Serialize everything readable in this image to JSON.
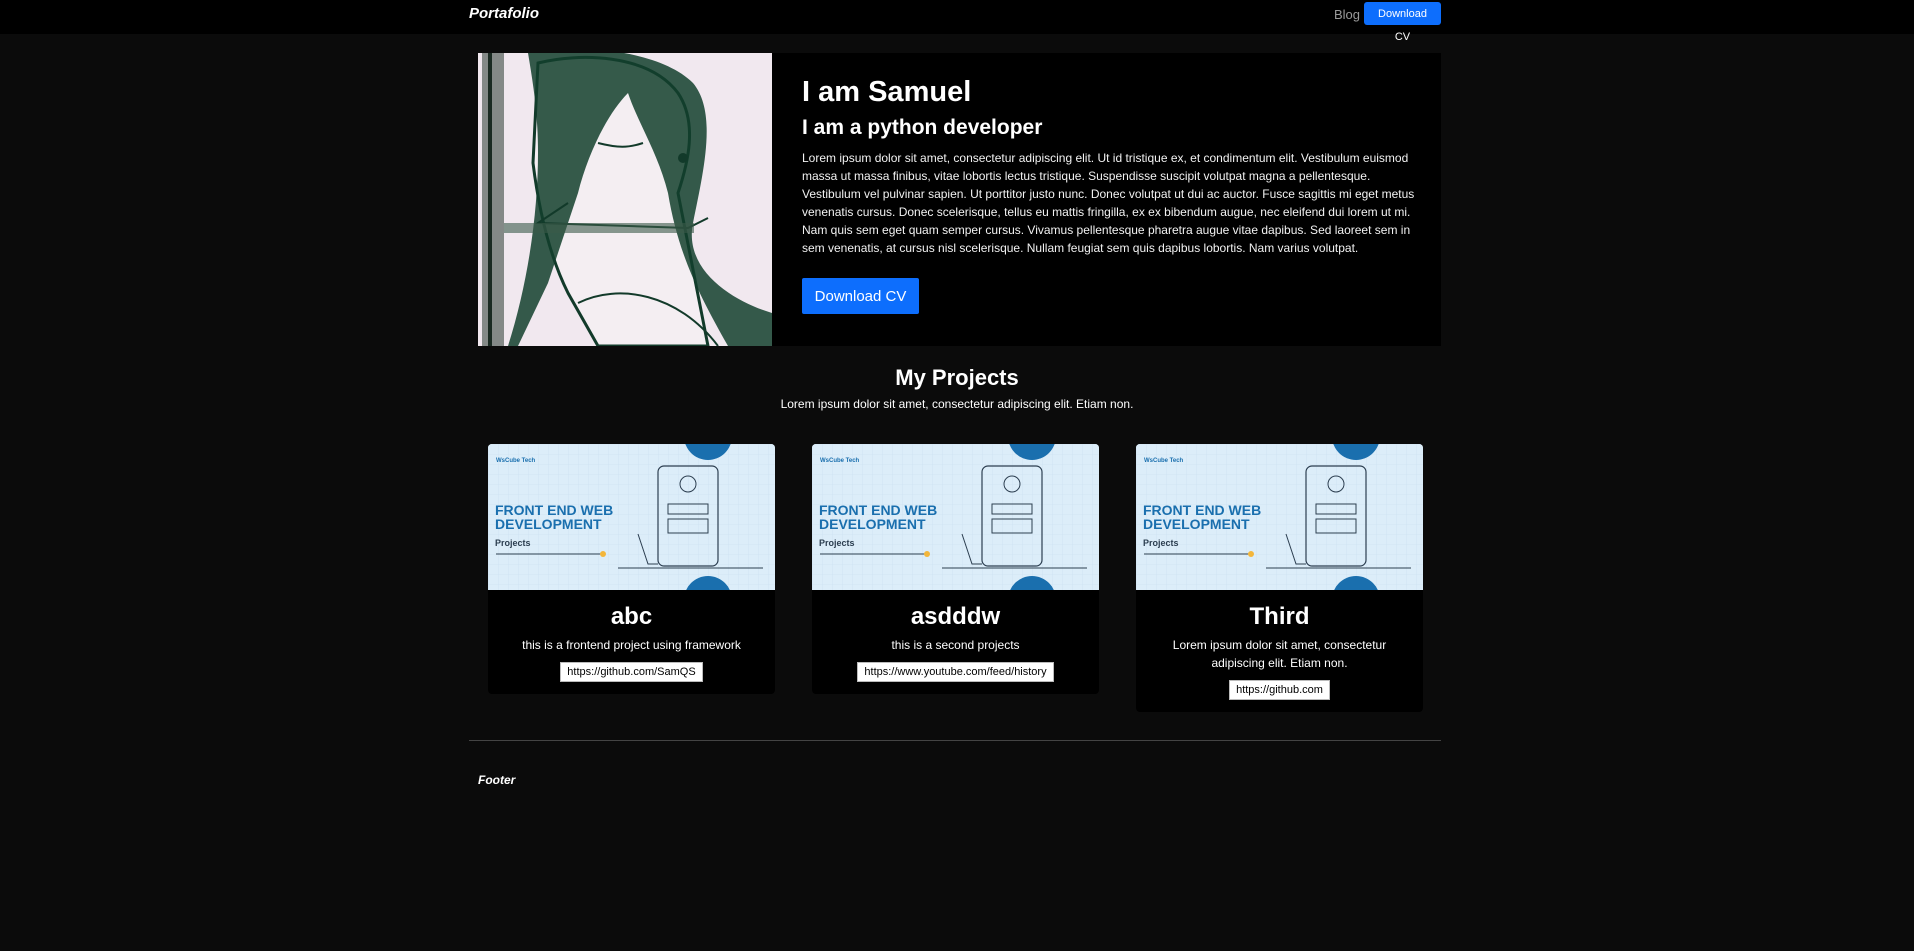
{
  "nav": {
    "brand": "Portafolio",
    "links": [
      {
        "label": "Blog"
      }
    ],
    "cta": "Download CV"
  },
  "hero": {
    "title_prefix": "I am ",
    "name": "Samuel",
    "subtitle": "I am a python developer",
    "description": "Lorem ipsum dolor sit amet, consectetur adipiscing elit. Ut id tristique ex, et condimentum elit. Vestibulum euismod massa ut massa finibus, vitae lobortis lectus tristique. Suspendisse suscipit volutpat magna a pellentesque. Vestibulum vel pulvinar sapien. Ut porttitor justo nunc. Donec volutpat ut dui ac auctor. Fusce sagittis mi eget metus venenatis cursus. Donec scelerisque, tellus eu mattis fringilla, ex ex bibendum augue, nec eleifend dui lorem ut mi. Nam quis sem eget quam semper cursus. Vivamus pellentesque pharetra augue vitae dapibus. Sed laoreet sem in sem venenatis, at cursus nisl scelerisque. Nullam feugiat sem quis dapibus lobortis. Nam varius volutpat.",
    "button": "Download CV"
  },
  "projects": {
    "title": "My Projects",
    "description": "Lorem ipsum dolor sit amet, consectetur adipiscing elit. Etiam non.",
    "banner": {
      "brand": "WsCube Tech",
      "line1": "FRONT END WEB",
      "line2": "DEVELOPMENT",
      "tag": "Projects"
    },
    "items": [
      {
        "title": "abc",
        "text": "this is a frontend project using framework",
        "link": "https://github.com/SamQS"
      },
      {
        "title": "asdddw",
        "text": "this is a second projects",
        "link": "https://www.youtube.com/feed/history"
      },
      {
        "title": "Third",
        "text": "Lorem ipsum dolor sit amet, consectetur adipiscing elit. Etiam non.",
        "link": "https://github.com"
      }
    ]
  },
  "footer": {
    "text": "Footer"
  },
  "colors": {
    "primary": "#0d6efd",
    "background": "#0b0b0b",
    "card": "#000000"
  }
}
